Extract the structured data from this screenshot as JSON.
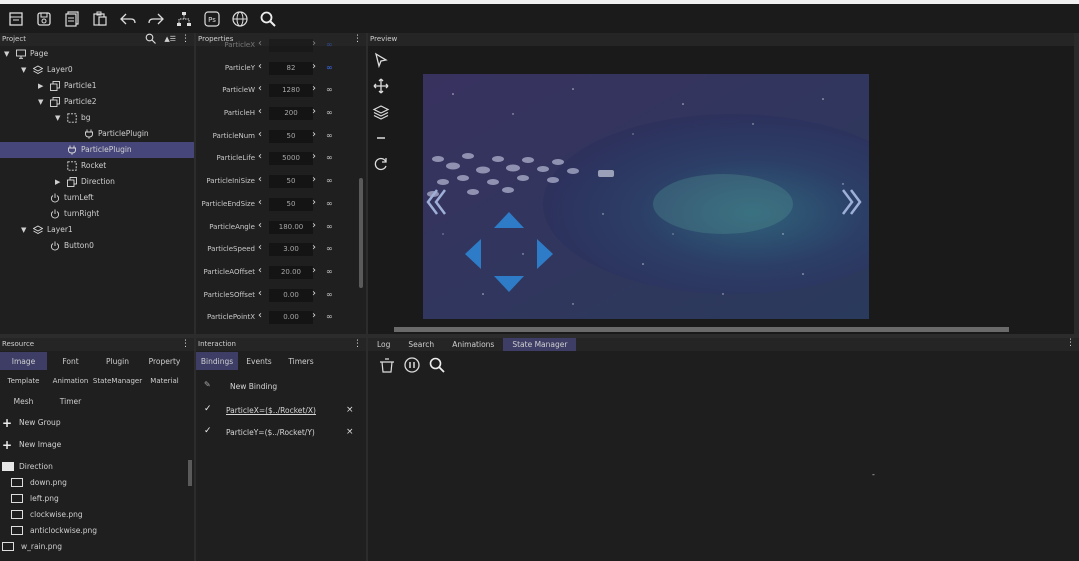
{
  "toolbar": {
    "icons": [
      "new-icon",
      "save-icon",
      "save-all-icon",
      "paste-icon",
      "undo-icon",
      "redo-icon",
      "tree-icon",
      "ps-icon",
      "globe-icon",
      "search-icon"
    ],
    "ps_label": "Ps"
  },
  "project": {
    "title": "Project",
    "tree": [
      {
        "label": "Page",
        "level": 0,
        "toggle": "▼",
        "icon": "monitor-icon"
      },
      {
        "label": "Layer0",
        "level": 1,
        "toggle": "▼",
        "icon": "layers-icon"
      },
      {
        "label": "Particle1",
        "level": 2,
        "toggle": "▶",
        "icon": "copy-icon"
      },
      {
        "label": "Particle2",
        "level": 2,
        "toggle": "▼",
        "icon": "copy-icon"
      },
      {
        "label": "bg",
        "level": 3,
        "toggle": "▼",
        "icon": "dashed-box-icon"
      },
      {
        "label": "ParticlePlugin",
        "level": 4,
        "toggle": "",
        "icon": "plug-icon"
      },
      {
        "label": "ParticlePlugin",
        "level": 3,
        "toggle": "",
        "icon": "plug-icon",
        "selected": true
      },
      {
        "label": "Rocket",
        "level": 3,
        "toggle": "",
        "icon": "dashed-box-icon"
      },
      {
        "label": "Direction",
        "level": 3,
        "toggle": "▶",
        "icon": "copy-icon"
      },
      {
        "label": "turnLeft",
        "level": 2,
        "toggle": "",
        "icon": "power-icon"
      },
      {
        "label": "turnRight",
        "level": 2,
        "toggle": "",
        "icon": "power-icon"
      },
      {
        "label": "Layer1",
        "level": 1,
        "toggle": "▼",
        "icon": "layers-icon"
      },
      {
        "label": "Button0",
        "level": 2,
        "toggle": "",
        "icon": "power-icon"
      }
    ]
  },
  "properties": {
    "title": "Properties",
    "rows": [
      {
        "name": "ParticleX",
        "value": "",
        "link": "∞"
      },
      {
        "name": "ParticleY",
        "value": "82",
        "link": "∞"
      },
      {
        "name": "ParticleW",
        "value": "1280",
        "link": "∞"
      },
      {
        "name": "ParticleH",
        "value": "200",
        "link": "∞"
      },
      {
        "name": "ParticleNum",
        "value": "50",
        "link": "∞"
      },
      {
        "name": "ParticleLife",
        "value": "5000",
        "link": "∞"
      },
      {
        "name": "ParticleIniSize",
        "value": "50",
        "link": "∞"
      },
      {
        "name": "ParticleEndSize",
        "value": "50",
        "link": "∞"
      },
      {
        "name": "ParticleAngle",
        "value": "180.00",
        "link": "∞"
      },
      {
        "name": "ParticleSpeed",
        "value": "3.00",
        "link": "∞"
      },
      {
        "name": "ParticleAOffset",
        "value": "20.00",
        "link": "∞"
      },
      {
        "name": "ParticleSOffset",
        "value": "0.00",
        "link": "∞"
      },
      {
        "name": "ParticlePointX",
        "value": "0.00",
        "link": "∞"
      }
    ]
  },
  "preview": {
    "title": "Preview"
  },
  "resource": {
    "title": "Resource",
    "tabs_row1": [
      "Image",
      "Font",
      "Plugin",
      "Property"
    ],
    "tabs_row2": [
      "Template",
      "Animation",
      "StateManager",
      "Material"
    ],
    "tabs_row3": [
      "Mesh",
      "Timer"
    ],
    "actions": [
      "New Group",
      "New Image"
    ],
    "folder": "Direction",
    "files": [
      "down.png",
      "left.png",
      "clockwise.png",
      "anticlockwise.png",
      "w_rain.png"
    ]
  },
  "interaction": {
    "title": "Interaction",
    "tabs": [
      "Bindings",
      "Events",
      "Timers"
    ],
    "new_binding": "New Binding",
    "bindings": [
      "ParticleX=($../Rocket/X)",
      "ParticleY=($../Rocket/Y)"
    ]
  },
  "bottom": {
    "tabs": [
      "Log",
      "Search",
      "Animations",
      "State Manager"
    ],
    "dash": "-"
  },
  "colors": {
    "accent": "#3d3d66",
    "selection": "#46467a",
    "link": "#3a6df0",
    "arrow": "#2e7cc7"
  }
}
